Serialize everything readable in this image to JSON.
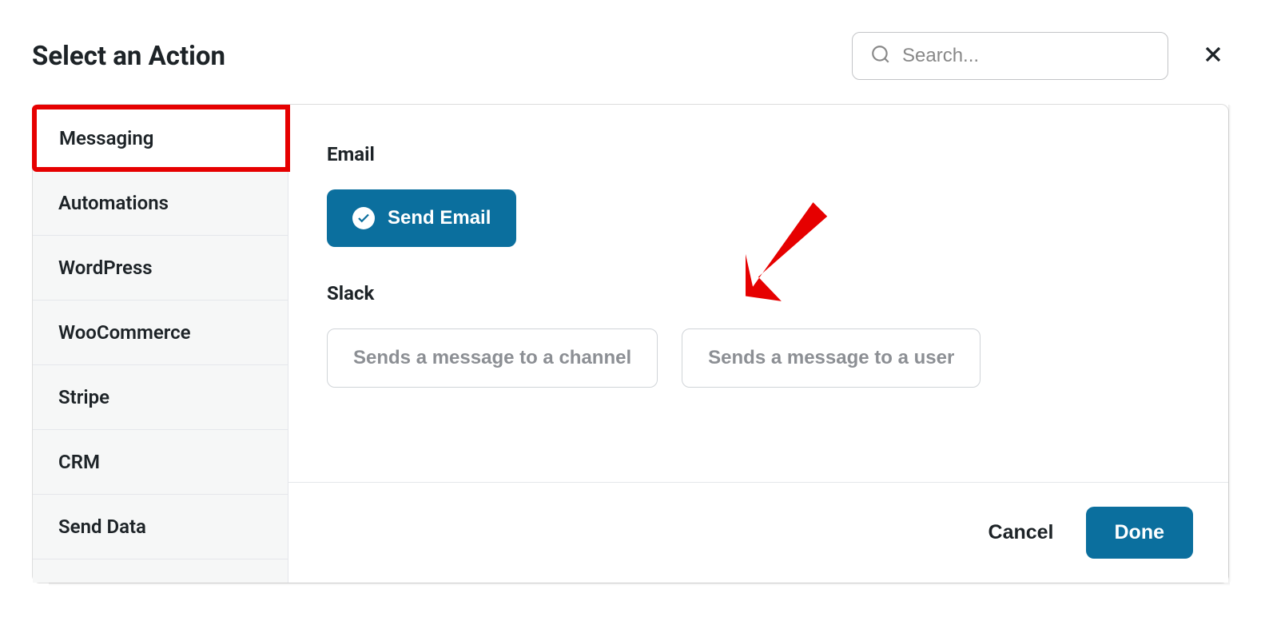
{
  "header": {
    "title": "Select an Action",
    "search_placeholder": "Search..."
  },
  "sidebar": {
    "items": [
      {
        "label": "Messaging",
        "active": true
      },
      {
        "label": "Automations",
        "active": false
      },
      {
        "label": "WordPress",
        "active": false
      },
      {
        "label": "WooCommerce",
        "active": false
      },
      {
        "label": "Stripe",
        "active": false
      },
      {
        "label": "CRM",
        "active": false
      },
      {
        "label": "Send Data",
        "active": false
      }
    ]
  },
  "sections": [
    {
      "title": "Email",
      "actions": [
        {
          "label": "Send Email",
          "selected": true
        }
      ]
    },
    {
      "title": "Slack",
      "actions": [
        {
          "label": "Sends a message to a channel",
          "selected": false
        },
        {
          "label": "Sends a message to a user",
          "selected": false
        }
      ]
    }
  ],
  "footer": {
    "cancel": "Cancel",
    "done": "Done"
  }
}
